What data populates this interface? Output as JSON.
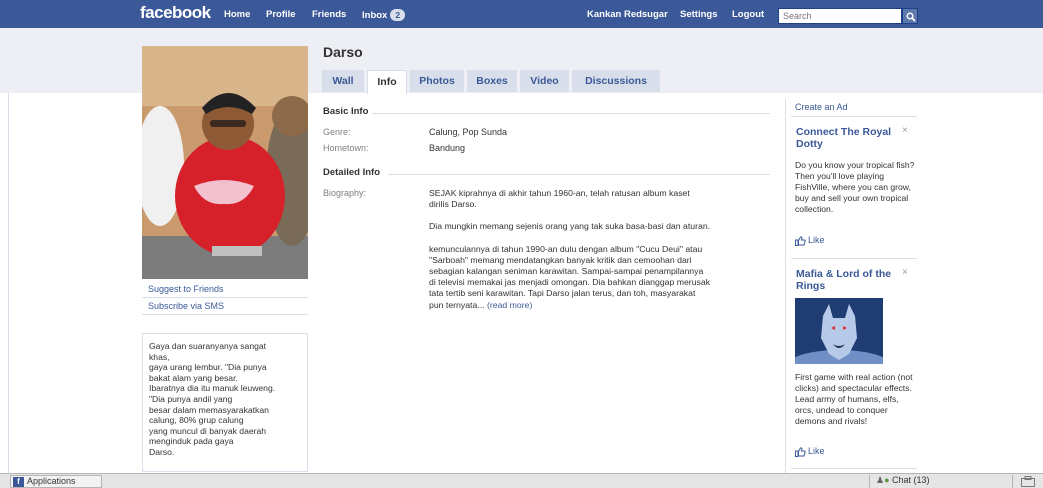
{
  "topbar": {
    "logo": "facebook",
    "nav": {
      "home": "Home",
      "profile": "Profile",
      "friends": "Friends",
      "inbox": "Inbox",
      "inbox_count": "2"
    },
    "user_name": "Kankan Redsugar",
    "settings": "Settings",
    "logout": "Logout",
    "search_placeholder": "Search",
    "accent": "#3b5998"
  },
  "profile": {
    "name": "Darso",
    "tabs": [
      "Wall",
      "Info",
      "Photos",
      "Boxes",
      "Video",
      "Discussions"
    ],
    "active_tab": "Info"
  },
  "left_panel": {
    "suggest": "Suggest to Friends",
    "subscribe": "Subscribe via SMS",
    "bio_box": "Gaya dan suaranyanya sangat\nkhas,\ngaya urang lembur. \"Dia punya\nbakat alam yang besar.\nIbaratnya dia itu manuk leuweng.\n\"Dia punya andil yang\nbesar dalam memasyarakatkan\ncalung, 80% grup calung\nyang muncul di banyak daerah\nmenginduk pada gaya\nDarso."
  },
  "info": {
    "basic_heading": "Basic Info",
    "genre_label": "Genre:",
    "genre_value": "Calung, Pop Sunda",
    "hometown_label": "Hometown:",
    "hometown_value": "Bandung",
    "detailed_heading": "Detailed Info",
    "biography_label": "Biography:",
    "biography_p1": "SEJAK kiprahnya di akhir tahun 1960-an, telah ratusan album kaset dirilis Darso.",
    "biography_p2": "Dia mungkin memang sejenis orang yang tak suka basa-basi dan aturan.",
    "biography_p3": "kemunculannya di tahun 1990-an dulu dengan album \"Cucu Deui\" atau \"Sarboah\" memang mendatangkan banyak kritik dan cemoohan dari sebagian kalangan seniman karawitan. Sampai-sampai penampilannya di televisi memakai jas menjadi omongan. Dia bahkan dianggap merusak tata tertib seni karawitan. Tapi Darso jalan terus, dan toh, masyarakat pun ternyata...",
    "read_more": "(read more)"
  },
  "ads": {
    "create_ad": "Create an Ad",
    "ad1": {
      "title": "Connect The Royal Dotty",
      "text": "Do you know your tropical fish? Then you'll love playing FishVille, where you can grow, buy and sell your own tropical collection.",
      "like": "Like"
    },
    "ad2": {
      "title": "Mafia & Lord of the Rings",
      "text": "First game with real action (not clicks) and spectacular effects. Lead army of humans, elfs, orcs, undead to conquer demons and rivals!",
      "like": "Like"
    },
    "close_glyph": "×"
  },
  "bottombar": {
    "applications": "Applications",
    "chat": "Chat (13)"
  }
}
